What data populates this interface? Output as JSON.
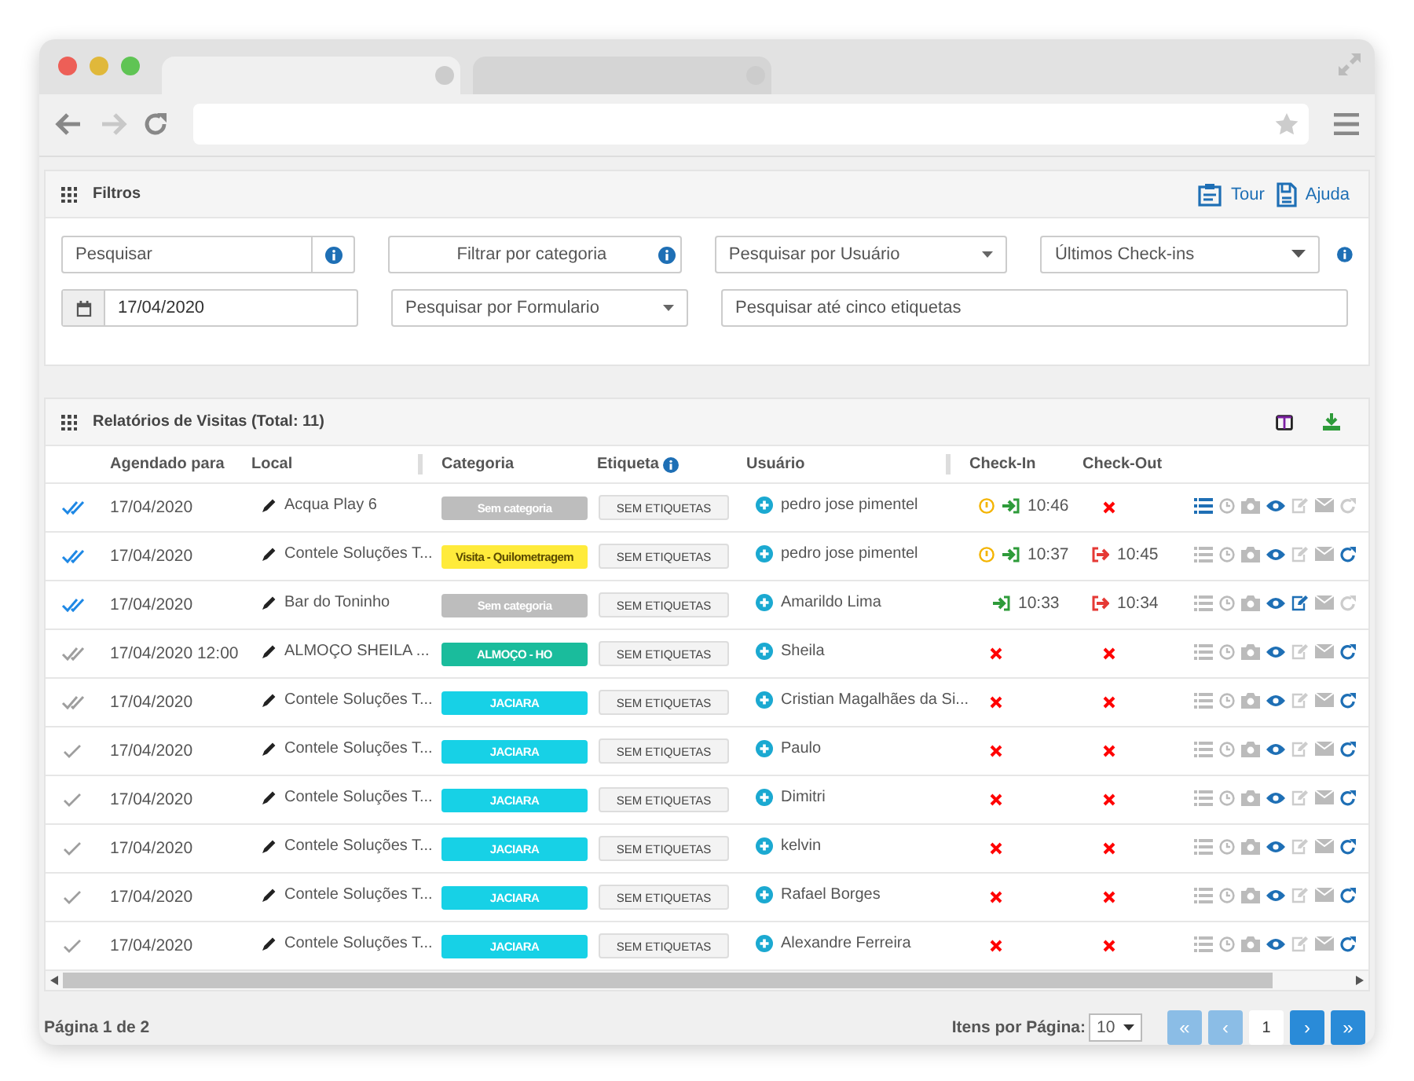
{
  "filters": {
    "title": "Filtros",
    "links": [
      {
        "kind": "tour",
        "label": "Tour"
      },
      {
        "kind": "help",
        "label": "Ajuda"
      }
    ],
    "search": {
      "placeholder": "Pesquisar"
    },
    "category_button": {
      "label": "Filtrar por categoria"
    },
    "user_select": {
      "placeholder": "Pesquisar por Usuário"
    },
    "checkins_select": {
      "value": "Últimos Check-ins"
    },
    "date": {
      "value": "17/04/2020"
    },
    "form_select": {
      "placeholder": "Pesquisar por Formulario"
    },
    "tags": {
      "placeholder": "Pesquisar até cinco etiquetas"
    }
  },
  "report": {
    "title": "Relatórios de Visitas (Total: 11)",
    "columns": [
      "Agendado para",
      "Local",
      "Categoria",
      "Etiqueta",
      "Usuário",
      "Check-In",
      "Check-Out"
    ],
    "rows": [
      {
        "read": true,
        "double_check": true,
        "date": "17/04/2020",
        "local": "Acqua Play 6",
        "category": {
          "label": "Sem categoria",
          "color": "#bdbdbd"
        },
        "tag": "SEM ETIQUETAS",
        "user": "pedro jose pimentel",
        "checkin": {
          "warning": true,
          "time": "10:46"
        },
        "checkout": null,
        "list_active": true,
        "edit_active": false,
        "refresh_active": false
      },
      {
        "read": true,
        "double_check": true,
        "date": "17/04/2020",
        "local": "Contele Soluções T...",
        "category": {
          "label": "Visita - Quilometragem",
          "color": "#ffeb3b"
        },
        "tag": "SEM ETIQUETAS",
        "user": "pedro jose pimentel",
        "checkin": {
          "warning": true,
          "time": "10:37"
        },
        "checkout": "10:45",
        "list_active": false,
        "edit_active": false,
        "refresh_active": true
      },
      {
        "read": true,
        "double_check": true,
        "date": "17/04/2020",
        "local": "Bar do Toninho",
        "category": {
          "label": "Sem categoria",
          "color": "#bdbdbd"
        },
        "tag": "SEM ETIQUETAS",
        "user": "Amarildo Lima",
        "checkin": {
          "warning": false,
          "time": "10:33"
        },
        "checkout": "10:34",
        "list_active": false,
        "edit_active": true,
        "refresh_active": false
      },
      {
        "read": false,
        "double_check": true,
        "date": "17/04/2020 12:00",
        "local": "ALMOÇO SHEILA ...",
        "category": {
          "label": "ALMOÇO - HO",
          "color": "#1abc9c"
        },
        "tag": "SEM ETIQUETAS",
        "user": "Sheila",
        "checkin": null,
        "checkout": null,
        "list_active": false,
        "edit_active": false,
        "refresh_active": true
      },
      {
        "read": false,
        "double_check": true,
        "date": "17/04/2020",
        "local": "Contele Soluções T...",
        "category": {
          "label": "JACIARA",
          "color": "#17d1e6"
        },
        "tag": "SEM ETIQUETAS",
        "user": "Cristian Magalhães da Si...",
        "checkin": null,
        "checkout": null,
        "list_active": false,
        "edit_active": false,
        "refresh_active": true
      },
      {
        "read": false,
        "double_check": false,
        "date": "17/04/2020",
        "local": "Contele Soluções T...",
        "category": {
          "label": "JACIARA",
          "color": "#17d1e6"
        },
        "tag": "SEM ETIQUETAS",
        "user": "Paulo",
        "checkin": null,
        "checkout": null,
        "list_active": false,
        "edit_active": false,
        "refresh_active": true
      },
      {
        "read": false,
        "double_check": false,
        "date": "17/04/2020",
        "local": "Contele Soluções T...",
        "category": {
          "label": "JACIARA",
          "color": "#17d1e6"
        },
        "tag": "SEM ETIQUETAS",
        "user": "Dimitri",
        "checkin": null,
        "checkout": null,
        "list_active": false,
        "edit_active": false,
        "refresh_active": true
      },
      {
        "read": false,
        "double_check": false,
        "date": "17/04/2020",
        "local": "Contele Soluções T...",
        "category": {
          "label": "JACIARA",
          "color": "#17d1e6"
        },
        "tag": "SEM ETIQUETAS",
        "user": "kelvin",
        "checkin": null,
        "checkout": null,
        "list_active": false,
        "edit_active": false,
        "refresh_active": true
      },
      {
        "read": false,
        "double_check": false,
        "date": "17/04/2020",
        "local": "Contele Soluções T...",
        "category": {
          "label": "JACIARA",
          "color": "#17d1e6"
        },
        "tag": "SEM ETIQUETAS",
        "user": "Rafael Borges",
        "checkin": null,
        "checkout": null,
        "list_active": false,
        "edit_active": false,
        "refresh_active": true
      },
      {
        "read": false,
        "double_check": false,
        "date": "17/04/2020",
        "local": "Contele Soluções T...",
        "category": {
          "label": "JACIARA",
          "color": "#17d1e6"
        },
        "tag": "SEM ETIQUETAS",
        "user": "Alexandre Ferreira",
        "checkin": null,
        "checkout": null,
        "list_active": false,
        "edit_active": false,
        "refresh_active": true
      }
    ]
  },
  "footer": {
    "page_info": "Página 1 de 2",
    "per_page_label": "Itens por Página:",
    "per_page_value": "10",
    "pagination": [
      {
        "label": "«",
        "disabled": true,
        "selected": false
      },
      {
        "label": "‹",
        "disabled": true,
        "selected": false
      },
      {
        "label": "1",
        "disabled": false,
        "selected": true
      },
      {
        "label": "›",
        "disabled": false,
        "selected": false
      },
      {
        "label": "»",
        "disabled": false,
        "selected": false
      }
    ]
  }
}
